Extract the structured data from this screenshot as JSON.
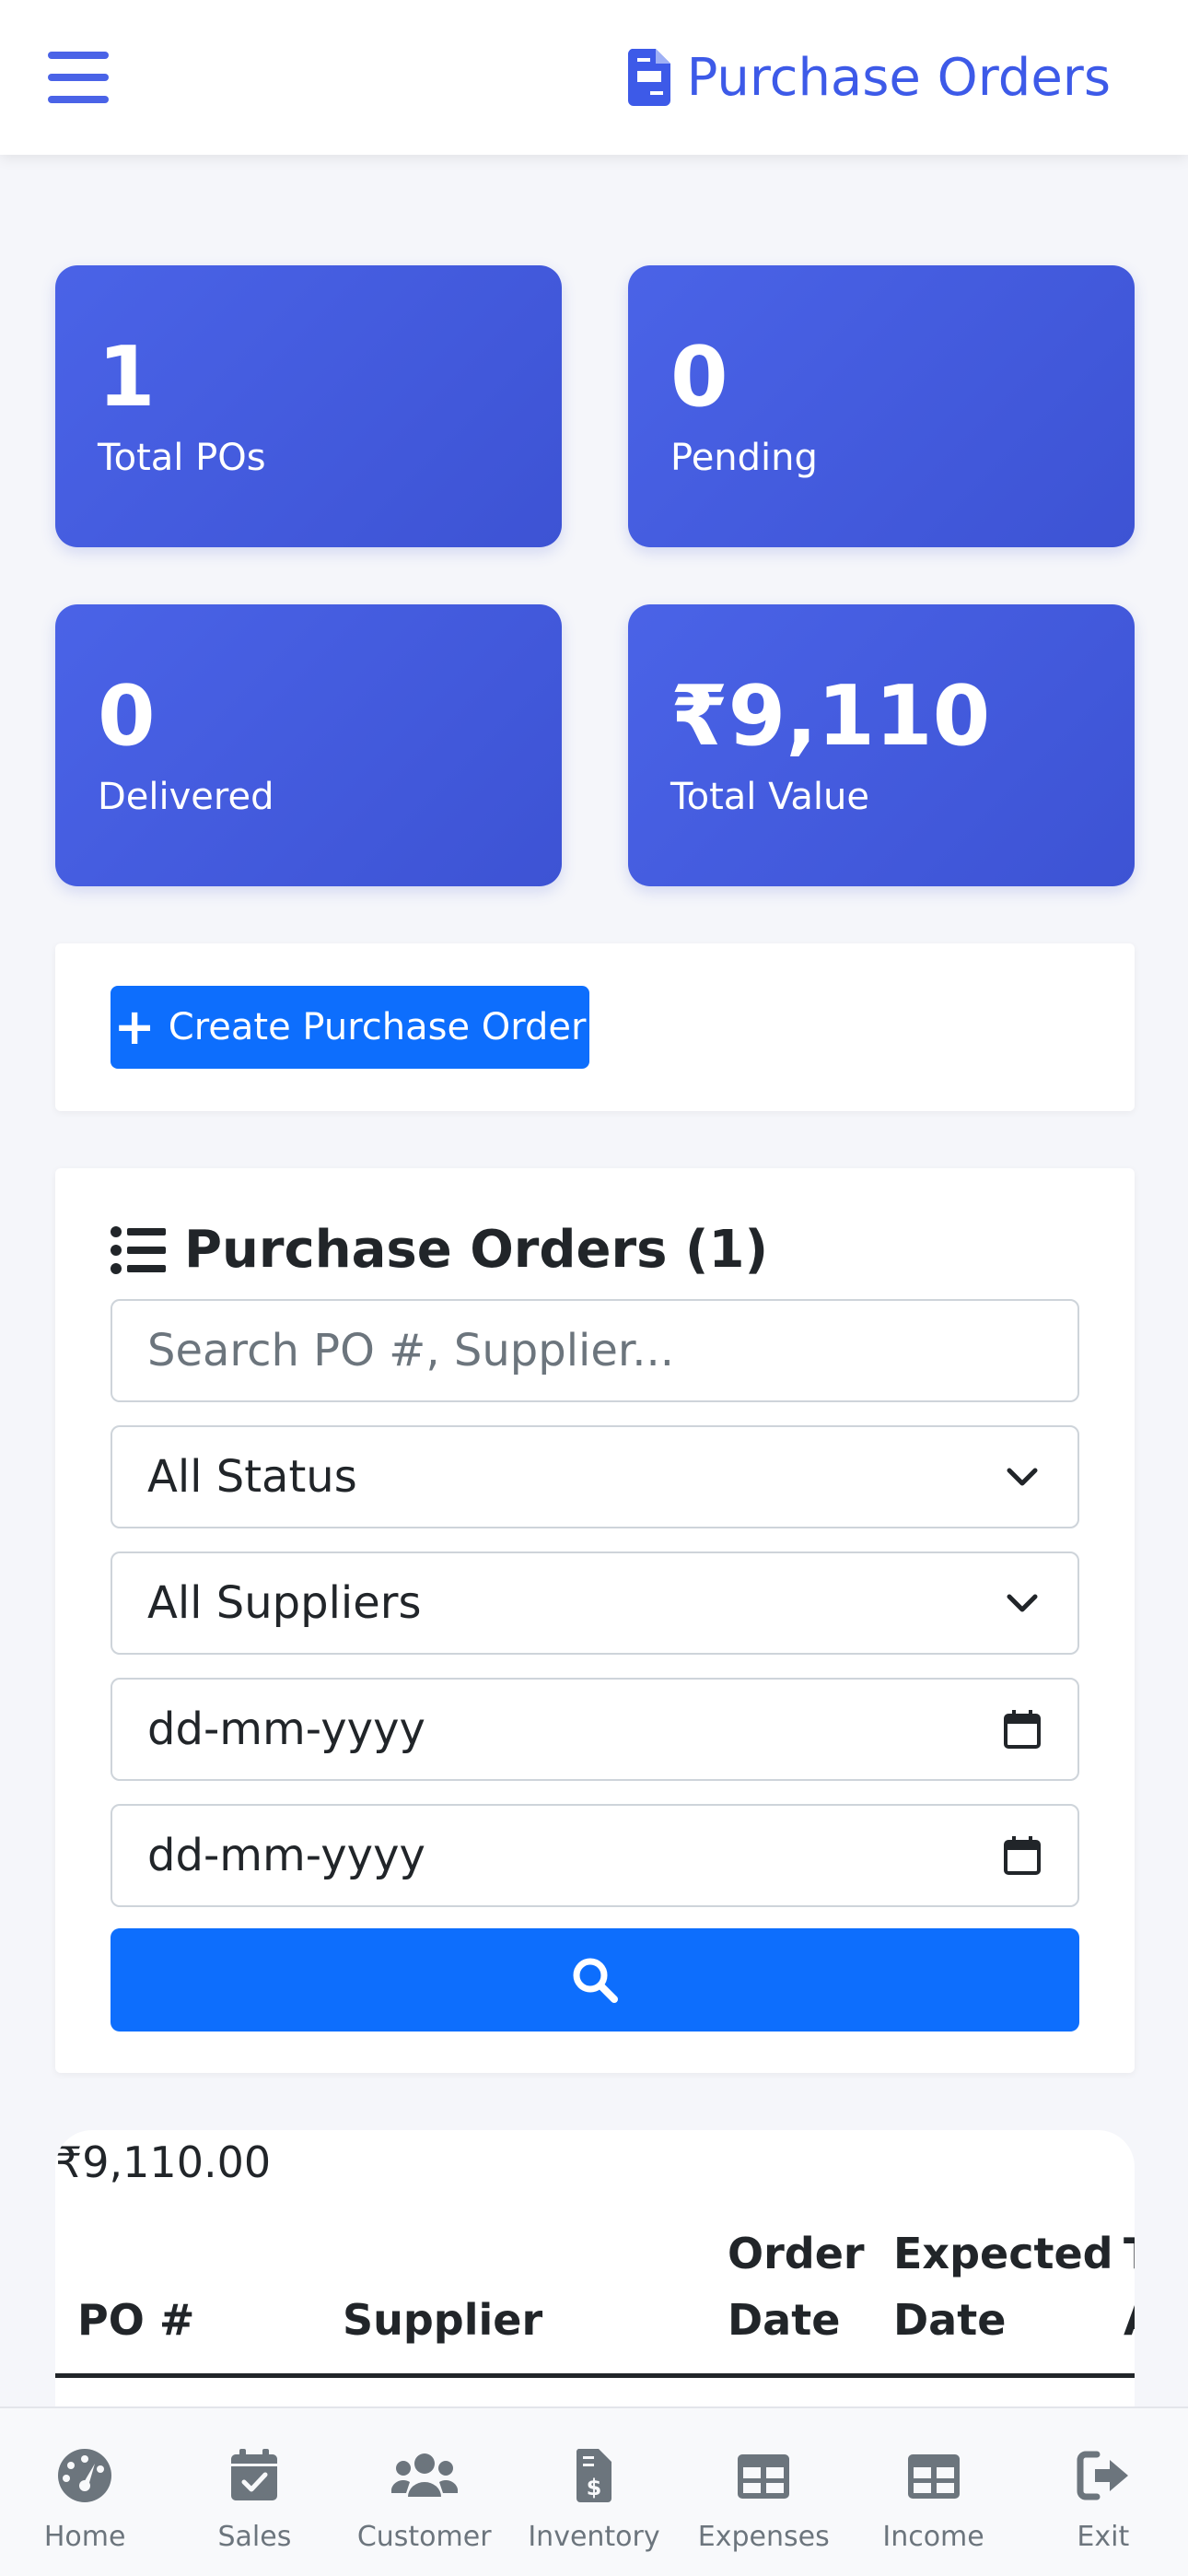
{
  "header": {
    "title": "Purchase Orders",
    "menu_icon": "hamburger-icon",
    "title_icon": "file-invoice-icon"
  },
  "stats": [
    {
      "value": "1",
      "label": "Total POs"
    },
    {
      "value": "0",
      "label": "Pending"
    },
    {
      "value": "0",
      "label": "Delivered"
    },
    {
      "value": "₹9,110",
      "label": "Total Value"
    }
  ],
  "actions": {
    "create_label": "Create Purchase Order"
  },
  "filters": {
    "title": "Purchase Orders (1)",
    "search_placeholder": "Search PO #, Supplier...",
    "status_value": "All Status",
    "supplier_value": "All Suppliers",
    "date_from_placeholder": "dd-mm-yyyy",
    "date_to_placeholder": "dd-mm-yyyy"
  },
  "table": {
    "total": "₹9,110.00",
    "headers": [
      "PO #",
      "Supplier",
      "Order Date",
      "Expected Date",
      "T A"
    ]
  },
  "nav": {
    "items": [
      {
        "label": "Home",
        "icon": "dashboard-gauge-icon"
      },
      {
        "label": "Sales",
        "icon": "calendar-check-icon"
      },
      {
        "label": "Customer",
        "icon": "users-icon"
      },
      {
        "label": "Inventory",
        "icon": "file-invoice-dollar-icon"
      },
      {
        "label": "Expenses",
        "icon": "table-icon"
      },
      {
        "label": "Income",
        "icon": "table-icon"
      },
      {
        "label": "Exit",
        "icon": "sign-out-icon"
      }
    ]
  },
  "colors": {
    "primary": "#0d6efd",
    "stat_bg": "#4a63e7",
    "brand": "#3d5ae8"
  }
}
